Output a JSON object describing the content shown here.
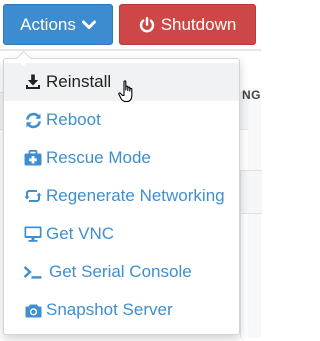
{
  "toolbar": {
    "actions_label": "Actions",
    "shutdown_label": "Shutdown"
  },
  "background": {
    "peek_text": "NG"
  },
  "menu": {
    "items": [
      {
        "label": "Reinstall",
        "icon": "download-icon"
      },
      {
        "label": "Reboot",
        "icon": "refresh-icon"
      },
      {
        "label": "Rescue Mode",
        "icon": "medkit-icon"
      },
      {
        "label": "Regenerate Networking",
        "icon": "retweet-icon"
      },
      {
        "label": "Get VNC",
        "icon": "desktop-icon"
      },
      {
        "label": "Get Serial Console",
        "icon": "terminal-icon"
      },
      {
        "label": "Snapshot Server",
        "icon": "camera-icon"
      }
    ]
  },
  "colors": {
    "primary": "#3d8ccf",
    "danger": "#cd4746",
    "link": "#3f8fd0"
  }
}
